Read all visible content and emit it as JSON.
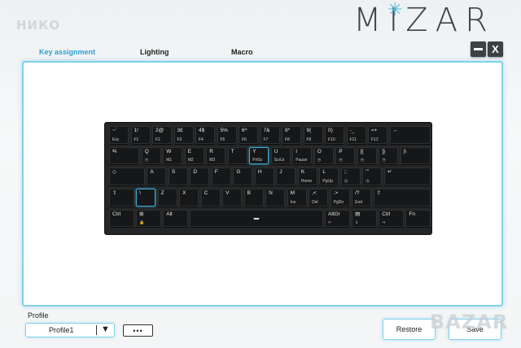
{
  "brand_left": "НИКО",
  "logo": "MIZAR",
  "tabs": [
    {
      "label": "Key assignment",
      "active": true
    },
    {
      "label": "Lighting",
      "active": false
    },
    {
      "label": "Macro",
      "active": false
    }
  ],
  "window_buttons": {
    "close_label": "X"
  },
  "keyboard": {
    "rows": [
      [
        {
          "t": "~`",
          "b": "Esc"
        },
        {
          "t": "1!",
          "b": "F1"
        },
        {
          "t": "2@",
          "b": "F2"
        },
        {
          "t": "3£",
          "b": "F3"
        },
        {
          "t": "4$",
          "b": "F4"
        },
        {
          "t": "5%",
          "b": "F5"
        },
        {
          "t": "6^",
          "b": "F6"
        },
        {
          "t": "7&",
          "b": "F7"
        },
        {
          "t": "8*",
          "b": "F8"
        },
        {
          "t": "9(",
          "b": "F9"
        },
        {
          "t": "0)",
          "b": "F10"
        },
        {
          "t": "-_",
          "b": "F11"
        },
        {
          "t": "=+",
          "b": "F12"
        },
        {
          "t": "←",
          "b": ""
        }
      ],
      [
        {
          "t": "⇆",
          "b": ""
        },
        {
          "t": "Q",
          "b": "◷"
        },
        {
          "t": "W",
          "b": "M1"
        },
        {
          "t": "E",
          "b": "M2"
        },
        {
          "t": "R",
          "b": "M3"
        },
        {
          "t": "T",
          "b": ""
        },
        {
          "t": "Y",
          "b": "PrtSc"
        },
        {
          "t": "U",
          "b": "ScrLk"
        },
        {
          "t": "I",
          "b": "Pause"
        },
        {
          "t": "O",
          "b": "◷"
        },
        {
          "t": "P",
          "b": "◷"
        },
        {
          "t": "[{",
          "b": "◷"
        },
        {
          "t": "]}",
          "b": "◷"
        },
        {
          "t": "|\\",
          "b": ""
        }
      ],
      [
        {
          "t": "◇",
          "b": ""
        },
        {
          "t": "A",
          "b": ""
        },
        {
          "t": "S",
          "b": ""
        },
        {
          "t": "D",
          "b": ""
        },
        {
          "t": "F",
          "b": ""
        },
        {
          "t": "G",
          "b": ""
        },
        {
          "t": "H",
          "b": ""
        },
        {
          "t": "J",
          "b": ""
        },
        {
          "t": "K",
          "b": "Home"
        },
        {
          "t": "L",
          "b": "PgUp"
        },
        {
          "t": ";:",
          "b": "◷"
        },
        {
          "t": "'\"",
          "b": "◷"
        },
        {
          "t": "↵",
          "b": ""
        }
      ],
      [
        {
          "t": "⇧",
          "b": ""
        },
        {
          "t": "\\",
          "b": ""
        },
        {
          "t": "Z",
          "b": ""
        },
        {
          "t": "X",
          "b": ""
        },
        {
          "t": "C",
          "b": ""
        },
        {
          "t": "V",
          "b": ""
        },
        {
          "t": "B",
          "b": ""
        },
        {
          "t": "N",
          "b": ""
        },
        {
          "t": "M",
          "b": "Ins"
        },
        {
          "t": ",<",
          "b": "Del"
        },
        {
          "t": ".>",
          "b": "PgDn"
        },
        {
          "t": "/?",
          "b": "End"
        },
        {
          "t": "⇧",
          "b": ""
        }
      ],
      [
        {
          "t": "Ctrl",
          "b": ""
        },
        {
          "t": "⊞",
          "b": "🔒"
        },
        {
          "t": "Alt",
          "b": ""
        },
        {
          "t": "▬",
          "b": ""
        },
        {
          "t": "AltGr",
          "b": "⇐"
        },
        {
          "t": "▤",
          "b": "⇓"
        },
        {
          "t": "Ctrl",
          "b": "⇒"
        },
        {
          "t": "Fn",
          "b": ""
        }
      ]
    ]
  },
  "profile": {
    "label": "Profile",
    "value": "Profile1",
    "more_label": "•••"
  },
  "buttons": {
    "restore": "Restore",
    "save": "Save"
  },
  "watermark": "BAZAR"
}
